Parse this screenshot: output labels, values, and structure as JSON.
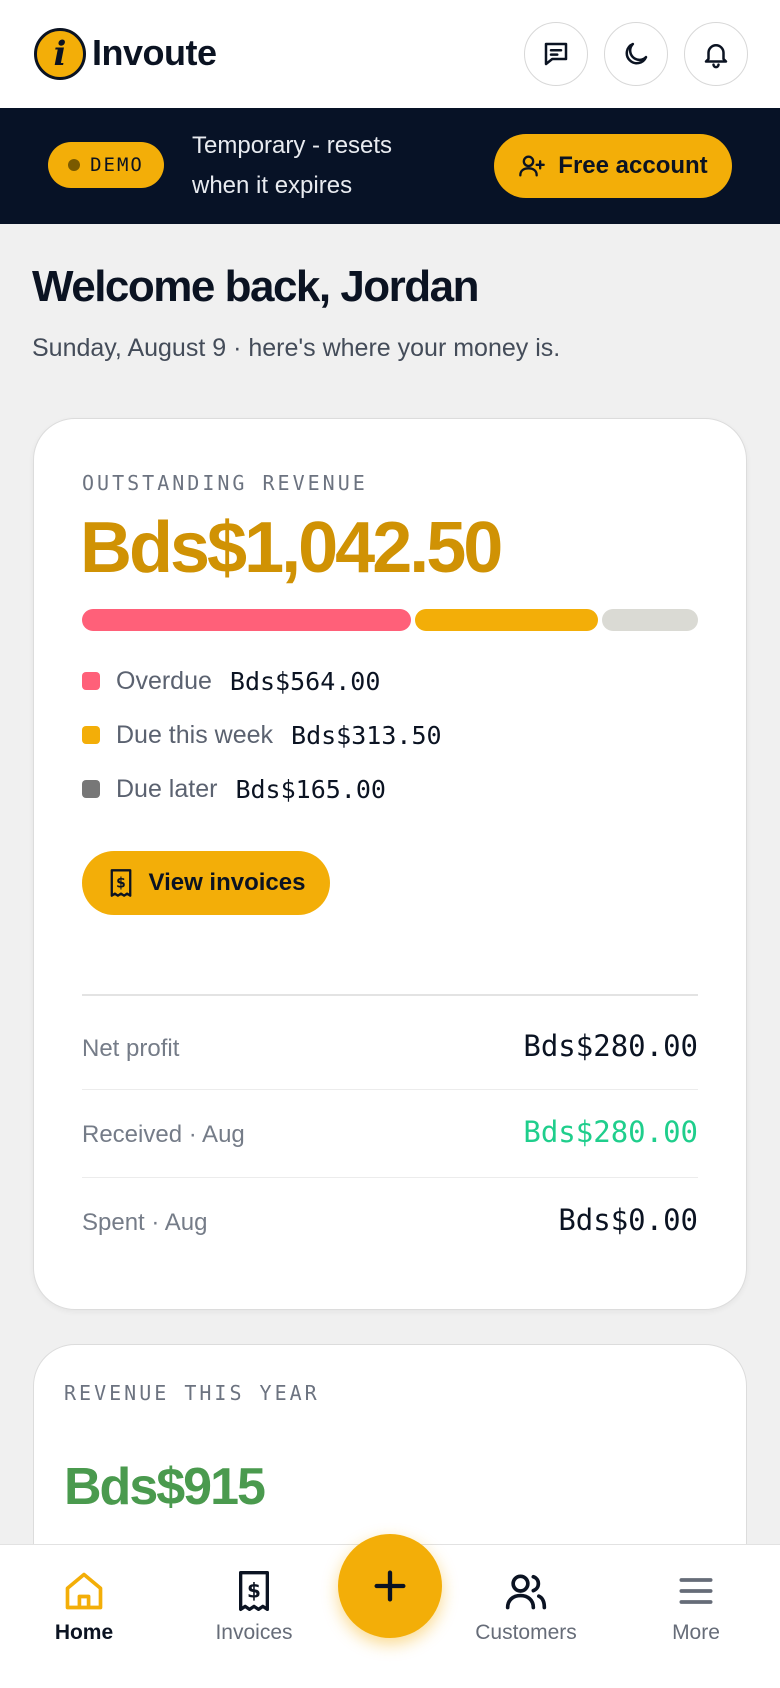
{
  "header": {
    "brand": "Invoute",
    "logo_letter": "i",
    "icons": [
      "chat-icon",
      "moon-icon",
      "bell-icon"
    ]
  },
  "banner": {
    "badge": "DEMO",
    "message": "Temporary - resets when it expires",
    "cta": "Free account"
  },
  "greeting": {
    "title": "Welcome back, Jordan",
    "subtitle": "Sunday, August 9 · here's where your money is."
  },
  "outstanding": {
    "label": "OUTSTANDING REVENUE",
    "total": "Bds$1,042.50",
    "breakdown": [
      {
        "label": "Overdue",
        "value": "Bds$564.00",
        "amount": 564.0,
        "color": "#ff6079"
      },
      {
        "label": "Due this week",
        "value": "Bds$313.50",
        "amount": 313.5,
        "color": "#f3ae08"
      },
      {
        "label": "Due later",
        "value": "Bds$165.00",
        "amount": 165.0,
        "color": "#dadad4"
      }
    ],
    "legend_later_dot_color": "#777777",
    "button": "View invoices"
  },
  "stats": [
    {
      "label": "Net profit",
      "value": "Bds$280.00",
      "color": "#0b1322"
    },
    {
      "label": "Received · Aug",
      "value": "Bds$280.00",
      "color": "#1fce8c"
    },
    {
      "label": "Spent · Aug",
      "value": "Bds$0.00",
      "color": "#0b1322"
    }
  ],
  "revenue_year": {
    "label": "REVENUE THIS YEAR",
    "value": "Bds$915"
  },
  "nav": {
    "items": [
      {
        "label": "Home",
        "icon": "home-icon",
        "active": true
      },
      {
        "label": "Invoices",
        "icon": "receipt-icon",
        "active": false
      },
      {
        "label": "Customers",
        "icon": "users-icon",
        "active": false
      },
      {
        "label": "More",
        "icon": "menu-icon",
        "active": false
      }
    ],
    "fab_icon": "plus-icon"
  },
  "colors": {
    "accent": "#f3ae08",
    "dark": "#071226",
    "amount_gold": "#d09204",
    "revenue_green": "#4a9a4e"
  }
}
